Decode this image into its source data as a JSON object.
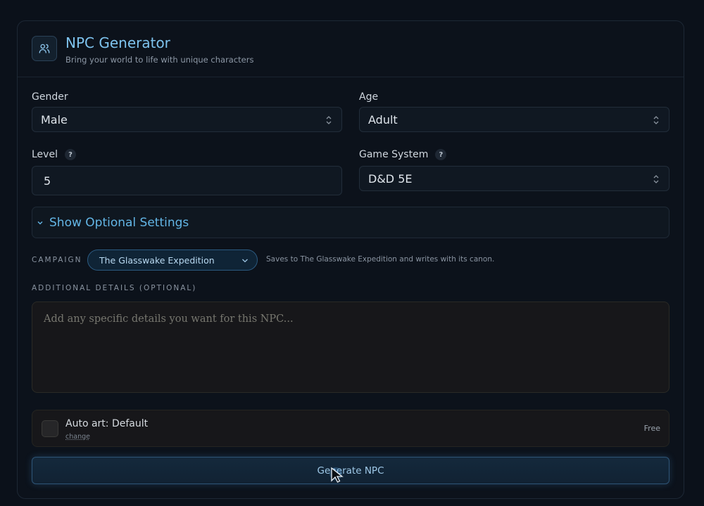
{
  "header": {
    "title": "NPC Generator",
    "subtitle": "Bring your world to life with unique characters",
    "icon": "users-icon"
  },
  "form": {
    "gender": {
      "label": "Gender",
      "value": "Male"
    },
    "age": {
      "label": "Age",
      "value": "Adult"
    },
    "level": {
      "label": "Level",
      "value": "5",
      "help": "?"
    },
    "game_system": {
      "label": "Game System",
      "value": "D&D 5E",
      "help": "?"
    },
    "optional_toggle": "Show Optional Settings",
    "campaign": {
      "label": "CAMPAIGN",
      "value": "The Glasswake Expedition",
      "note": "Saves to The Glasswake Expedition and writes with its canon."
    },
    "details": {
      "label": "ADDITIONAL DETAILS (OPTIONAL)",
      "placeholder": "Add any specific details you want for this NPC..."
    },
    "auto_art": {
      "title": "Auto art: Default",
      "change": "change",
      "price": "Free"
    },
    "generate_label": "Generate NPC"
  },
  "colors": {
    "accent": "#7ec3ee",
    "background": "#0b111a"
  }
}
